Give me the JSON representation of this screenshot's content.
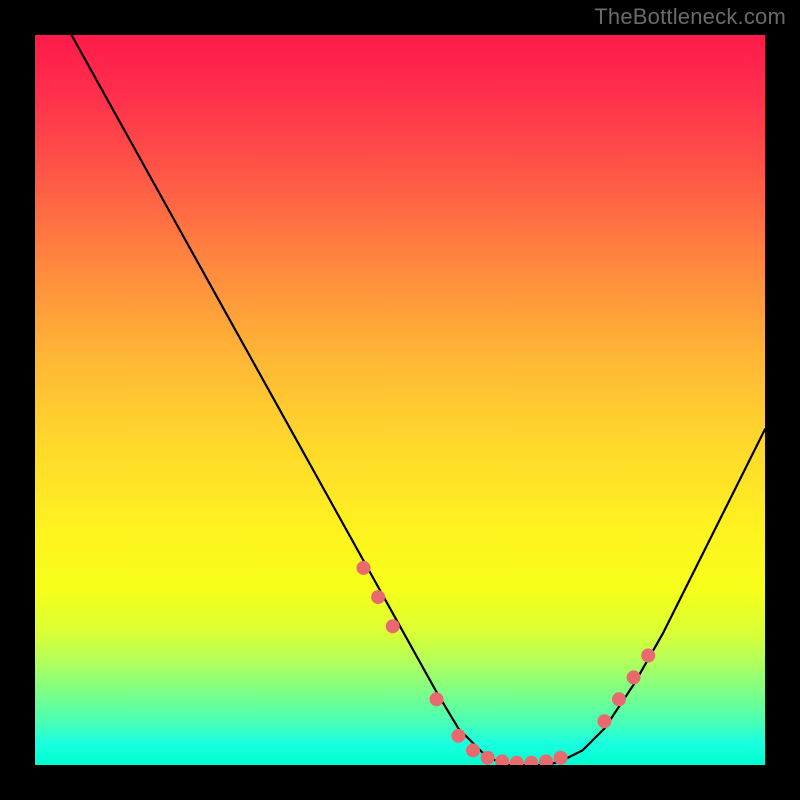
{
  "attribution": "TheBottleneck.com",
  "chart_data": {
    "type": "line",
    "title": "",
    "xlabel": "",
    "ylabel": "",
    "xlim": [
      0,
      100
    ],
    "ylim": [
      0,
      100
    ],
    "series": [
      {
        "name": "bottleneck-curve",
        "x": [
          5,
          10,
          15,
          20,
          25,
          30,
          35,
          40,
          45,
          50,
          55,
          58,
          60,
          62,
          65,
          68,
          70,
          72,
          75,
          78,
          82,
          86,
          90,
          95,
          100
        ],
        "y": [
          100,
          91,
          82,
          73,
          64,
          55,
          46,
          37,
          28,
          19,
          10,
          5,
          3,
          1,
          0,
          0,
          0,
          0.5,
          2,
          5,
          11,
          18,
          26,
          36,
          46
        ]
      }
    ],
    "markers": {
      "name": "highlight-points",
      "x": [
        45,
        47,
        49,
        55,
        58,
        60,
        62,
        64,
        66,
        68,
        70,
        72,
        78,
        80,
        82,
        84
      ],
      "y": [
        27,
        23,
        19,
        9,
        4,
        2,
        1,
        0.5,
        0.3,
        0.3,
        0.5,
        1,
        6,
        9,
        12,
        15
      ]
    },
    "gradient_bands": [
      {
        "pos": 0,
        "color": "#ff1a4a"
      },
      {
        "pos": 20,
        "color": "#ff5a46"
      },
      {
        "pos": 44,
        "color": "#ffb636"
      },
      {
        "pos": 68,
        "color": "#fff31f"
      },
      {
        "pos": 86,
        "color": "#b0ff5d"
      },
      {
        "pos": 100,
        "color": "#00ffce"
      }
    ]
  }
}
